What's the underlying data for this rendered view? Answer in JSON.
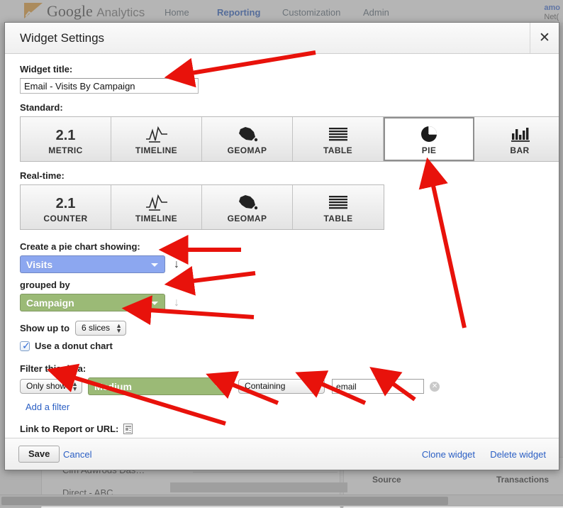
{
  "background": {
    "brand": "Google",
    "brand_sub": "Analytics",
    "nav": [
      {
        "label": "Home",
        "active": false
      },
      {
        "label": "Reporting",
        "active": true
      },
      {
        "label": "Customization",
        "active": false
      },
      {
        "label": "Admin",
        "active": false
      }
    ],
    "account": {
      "line1": "amo",
      "line2": "Net("
    },
    "rows": [
      {
        "label": "Clm Adwrods Das…"
      },
      {
        "label": "Direct - ABC"
      }
    ],
    "table_headers": [
      "Source",
      "Transactions"
    ]
  },
  "dialog": {
    "title": "Widget Settings",
    "close_label": "✕",
    "widget_title_label": "Widget title:",
    "widget_title_value": "Email - Visits By Campaign",
    "standard_label": "Standard:",
    "realtime_label": "Real-time:",
    "standard_types": [
      {
        "name": "METRIC",
        "icon": "metric-icon",
        "glyph": "2.1",
        "selected": false
      },
      {
        "name": "TIMELINE",
        "icon": "timeline-icon",
        "glyph": "",
        "selected": false
      },
      {
        "name": "GEOMAP",
        "icon": "geomap-icon",
        "glyph": "",
        "selected": false
      },
      {
        "name": "TABLE",
        "icon": "table-icon",
        "glyph": "",
        "selected": false
      },
      {
        "name": "PIE",
        "icon": "pie-icon",
        "glyph": "",
        "selected": true
      },
      {
        "name": "BAR",
        "icon": "bar-icon",
        "glyph": "",
        "selected": false
      }
    ],
    "realtime_types": [
      {
        "name": "COUNTER",
        "icon": "counter-icon",
        "glyph": "2.1",
        "selected": false
      },
      {
        "name": "TIMELINE",
        "icon": "timeline-icon",
        "glyph": "",
        "selected": false
      },
      {
        "name": "GEOMAP",
        "icon": "geomap-icon",
        "glyph": "",
        "selected": false
      },
      {
        "name": "TABLE",
        "icon": "table-icon",
        "glyph": "",
        "selected": false
      }
    ],
    "create_label": "Create a pie chart showing:",
    "metric_value": "Visits",
    "metric_color": "#8ca7f0",
    "grouped_by_label": "grouped by",
    "dimension_value": "Campaign",
    "dimension_color": "#9bba76",
    "show_up_to_label": "Show up to",
    "slices_value": "6 slices",
    "donut_label": "Use a donut chart",
    "donut_checked": true,
    "filter_label": "Filter this data:",
    "filter_mode": "Only show",
    "filter_dimension": "Medium",
    "filter_dimension_color": "#9bba76",
    "filter_match": "Containing",
    "filter_text": "email",
    "clear_label": "✕",
    "add_filter_label": "Add a filter",
    "link_label": "Link to Report or URL:",
    "link_value": "",
    "link_placeholder": ""
  },
  "footer": {
    "save_label": "Save",
    "cancel_label": "Cancel",
    "clone_label": "Clone widget",
    "delete_label": "Delete widget"
  },
  "annotations": {
    "color": "#e8120b",
    "count": 8,
    "description": "red arrows pointing at widget title, pie type, metric select, dimension select, slices stepper, filter mode, filter dimension, match type and filter text"
  }
}
